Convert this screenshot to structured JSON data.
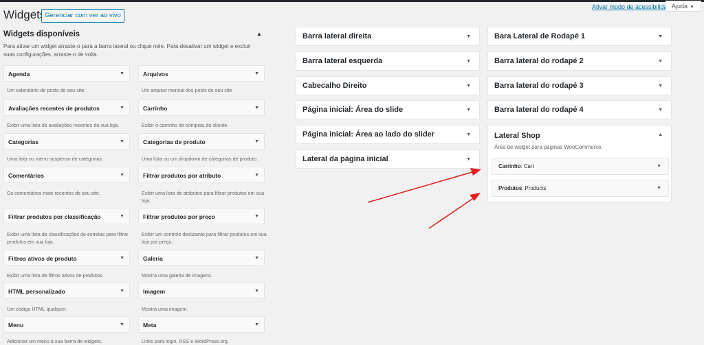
{
  "header": {
    "title": "Widgets",
    "live_button": "Gerenciar com ver ao vivo",
    "accessibility_link": "Ativar modo de acessibilidade",
    "help_label": "Ajuda"
  },
  "available": {
    "heading": "Widgets disponíveis",
    "description": "Para ativar um widget arraste-o para a barra lateral ou clique nele. Para desativar um widget e excluir suas configurações, arraste-o de volta.",
    "widgets": [
      {
        "name": "Agenda",
        "desc": "Um calendário de posts de seu site."
      },
      {
        "name": "Arquivos",
        "desc": "Um arquivo mensal dos posts do seu site"
      },
      {
        "name": "Avaliações recentes de produtos",
        "desc": "Exibir uma lista de avaliações recentes da sua loja."
      },
      {
        "name": "Carrinho",
        "desc": "Exibir o carrinho de compras do cliente."
      },
      {
        "name": "Categorias",
        "desc": "Uma lista ou menu suspenso de categorias."
      },
      {
        "name": "Categorias de produto",
        "desc": "Uma lista ou um dropdown de categorias de produto."
      },
      {
        "name": "Comentários",
        "desc": "Os comentários mais recentes de seu site."
      },
      {
        "name": "Filtrar produtos por atributo",
        "desc": "Exibir uma lista de atributos para filtrar produtos em sua loja."
      },
      {
        "name": "Filtrar produtos por classificação",
        "desc": "Exibir uma lista de classificações de estrelas para filtrar produtos em sua loja."
      },
      {
        "name": "Filtrar produtos por preço",
        "desc": "Exibir um controle deslizante para filtrar produtos em sua loja por preço."
      },
      {
        "name": "Filtros ativos de produto",
        "desc": "Exibir uma lista de filtros ativos de produtos."
      },
      {
        "name": "Galeria",
        "desc": "Mostra uma galeria de imagens."
      },
      {
        "name": "HTML personalizado",
        "desc": "Um código HTML qualquer."
      },
      {
        "name": "Imagem",
        "desc": "Mostra uma imagem."
      },
      {
        "name": "Menu",
        "desc": "Adicionar um menu à sua barra de widgets."
      },
      {
        "name": "Meta",
        "desc": "Links para login, RSS e WordPress.org."
      }
    ]
  },
  "sidebars_col1": [
    {
      "name": "Barra lateral direita"
    },
    {
      "name": "Barra lateral esquerda"
    },
    {
      "name": "Cabecalho Direito"
    },
    {
      "name": "Página inicial: Área do slide"
    },
    {
      "name": "Página inicial: Área ao lado do slider"
    },
    {
      "name": "Lateral da página inicial"
    }
  ],
  "sidebars_col2": [
    {
      "name": "Bara Lateral de Rodapé 1"
    },
    {
      "name": "Barra lateral do rodapé 2"
    },
    {
      "name": "Barra lateral do rodapé 3"
    },
    {
      "name": "Barra lateral do rodapé 4"
    }
  ],
  "lateral_shop": {
    "title": "Lateral Shop",
    "description": "Área de widget para páginas WooCommerce.",
    "widgets": [
      {
        "type": "Carrinho",
        "title": ": Cart"
      },
      {
        "type": "Produtos",
        "title": ": Products"
      }
    ]
  },
  "icons": {
    "collapse": "triangle-up-icon",
    "expand": "triangle-down-icon"
  },
  "colors": {
    "link": "#0073aa",
    "annotation_arrow": "#e02020"
  }
}
